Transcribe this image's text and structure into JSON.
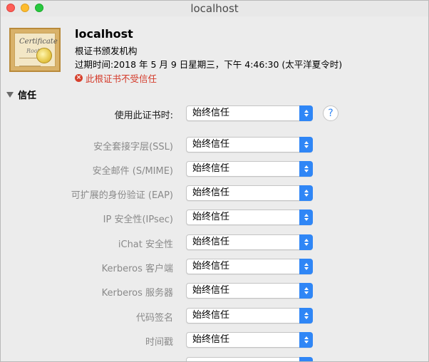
{
  "window": {
    "title": "localhost"
  },
  "certificate": {
    "icon_text_1": "Certificate",
    "icon_text_2": "Root",
    "name": "localhost",
    "issuer": "根证书颁发机构",
    "expiry": "过期时间:2018 年 5 月 9 日星期三，下午 4:46:30 (太平洋夏令时)",
    "warning": "此根证书不受信任",
    "warning_icon": "x-circle-icon"
  },
  "trust": {
    "section_label": "信任",
    "help_label": "?",
    "rows": [
      {
        "label": "使用此证书时:",
        "value": "始终信任"
      },
      {
        "label": "安全套接字层(SSL)",
        "value": "始终信任"
      },
      {
        "label": "安全邮件 (S/MIME)",
        "value": "始终信任"
      },
      {
        "label": "可扩展的身份验证 (EAP)",
        "value": "始终信任"
      },
      {
        "label": "IP 安全性(IPsec)",
        "value": "始终信任"
      },
      {
        "label": "iChat 安全性",
        "value": "始终信任"
      },
      {
        "label": "Kerberos 客户端",
        "value": "始终信任"
      },
      {
        "label": "Kerberos 服务器",
        "value": "始终信任"
      },
      {
        "label": "代码签名",
        "value": "始终信任"
      },
      {
        "label": "时间戳",
        "value": "始终信任"
      }
    ]
  }
}
